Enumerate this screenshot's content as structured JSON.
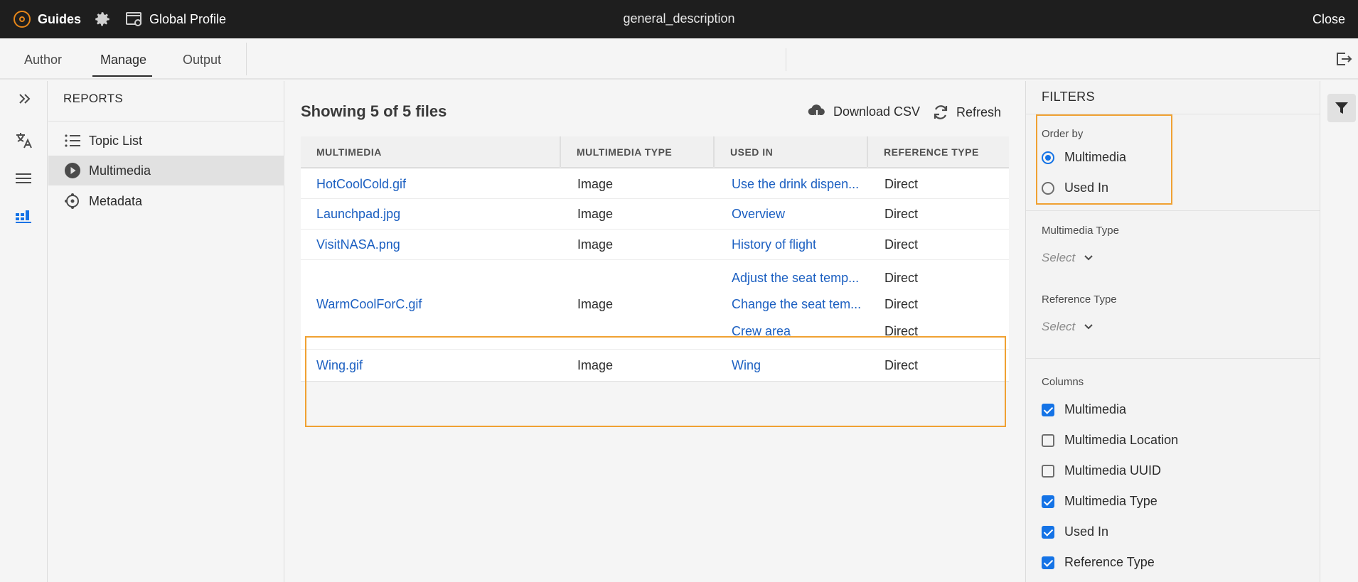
{
  "header": {
    "brand": "Guides",
    "profile_label": "Global Profile",
    "document_title": "general_description",
    "close_label": "Close"
  },
  "tabs": [
    {
      "label": "Author",
      "active": false
    },
    {
      "label": "Manage",
      "active": true
    },
    {
      "label": "Output",
      "active": false
    }
  ],
  "left_rail": {
    "icons": [
      "expand-icon",
      "translate-icon",
      "list-icon",
      "reports-icon"
    ]
  },
  "reports": {
    "title": "REPORTS",
    "items": [
      {
        "label": "Topic List",
        "icon": "topic-list-icon",
        "active": false
      },
      {
        "label": "Multimedia",
        "icon": "play-icon",
        "active": true
      },
      {
        "label": "Metadata",
        "icon": "metadata-icon",
        "active": false
      }
    ]
  },
  "main": {
    "showing": "Showing 5 of 5 files",
    "download_label": "Download CSV",
    "refresh_label": "Refresh",
    "columns": [
      "MULTIMEDIA",
      "MULTIMEDIA TYPE",
      "USED IN",
      "REFERENCE TYPE"
    ],
    "rows": [
      {
        "file": "HotCoolCold.gif",
        "type": "Image",
        "used_in": [
          "Use the drink dispen..."
        ],
        "ref": [
          "Direct"
        ]
      },
      {
        "file": "Launchpad.jpg",
        "type": "Image",
        "used_in": [
          "Overview"
        ],
        "ref": [
          "Direct"
        ]
      },
      {
        "file": "VisitNASA.png",
        "type": "Image",
        "used_in": [
          "History of flight"
        ],
        "ref": [
          "Direct"
        ]
      },
      {
        "file": "WarmCoolForC.gif",
        "type": "Image",
        "used_in": [
          "Adjust the seat temp...",
          "Change the seat tem...",
          "Crew area"
        ],
        "ref": [
          "Direct",
          "Direct",
          "Direct"
        ]
      },
      {
        "file": "Wing.gif",
        "type": "Image",
        "used_in": [
          "Wing"
        ],
        "ref": [
          "Direct"
        ]
      }
    ]
  },
  "filters": {
    "title": "FILTERS",
    "order_by_label": "Order by",
    "order_by_options": [
      {
        "label": "Multimedia",
        "selected": true
      },
      {
        "label": "Used In",
        "selected": false
      }
    ],
    "multimedia_type_label": "Multimedia Type",
    "multimedia_type_value": "Select",
    "reference_type_label": "Reference Type",
    "reference_type_value": "Select",
    "columns_label": "Columns",
    "columns": [
      {
        "label": "Multimedia",
        "checked": true
      },
      {
        "label": "Multimedia Location",
        "checked": false
      },
      {
        "label": "Multimedia UUID",
        "checked": false
      },
      {
        "label": "Multimedia Type",
        "checked": true
      },
      {
        "label": "Used In",
        "checked": true
      },
      {
        "label": "Reference Type",
        "checked": true
      }
    ]
  },
  "colors": {
    "accent": "#1473e6",
    "link": "#1b5fc1",
    "highlight": "#f0a132",
    "header_bg": "#1e1e1e"
  }
}
